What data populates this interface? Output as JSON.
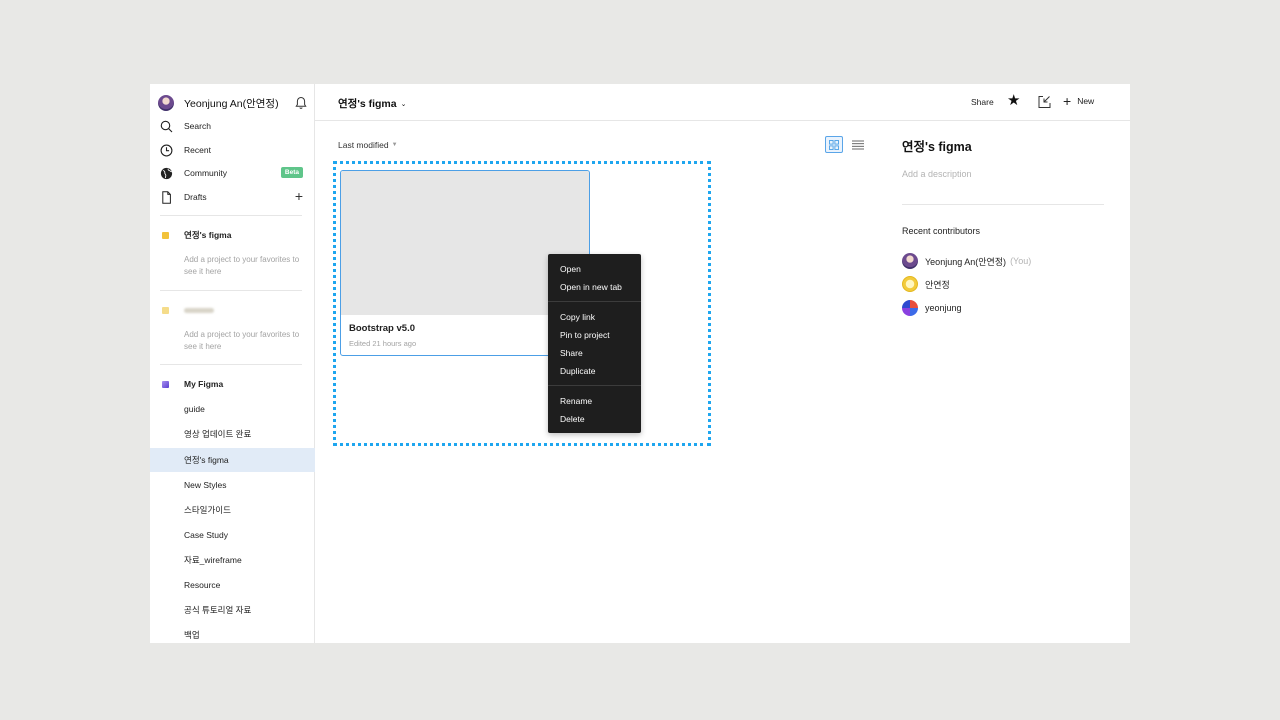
{
  "sidebar": {
    "user_name": "Yeonjung An(안연정)",
    "nav": [
      {
        "label": "Search",
        "icon": "search-icon"
      },
      {
        "label": "Recent",
        "icon": "clock-icon"
      },
      {
        "label": "Community",
        "icon": "globe-icon",
        "badge": "Beta"
      },
      {
        "label": "Drafts",
        "icon": "file-icon",
        "action": "+"
      }
    ],
    "teams": [
      {
        "label": "연정's figma",
        "color": "#f2c23a",
        "hint": "Add a project to your favorites to see it here"
      },
      {
        "label": "",
        "color": "#f5dc8a",
        "hint": "Add a project to your favorites to see it here"
      },
      {
        "label": "My Figma",
        "color": "#7b5fe0"
      }
    ],
    "projects": [
      "guide",
      "영상 업데이트 완료",
      "연정's figma",
      "New Styles",
      "스타일가이드",
      "Case Study",
      "자료_wireframe",
      "Resource",
      "공식 튜토리얼 자료",
      "백업"
    ],
    "active_project": "연정's figma"
  },
  "topbar": {
    "title": "연정's figma",
    "share_label": "Share",
    "new_label": "New"
  },
  "main": {
    "sort_label": "Last modified",
    "file": {
      "name": "Bootstrap v5.0",
      "meta": "Edited 21 hours ago"
    },
    "context_menu": [
      "Open",
      "Open in new tab",
      "Copy link",
      "Pin to project",
      "Share",
      "Duplicate",
      "Rename",
      "Delete"
    ]
  },
  "right_panel": {
    "title": "연정's figma",
    "description_placeholder": "Add a description",
    "contributors_heading": "Recent contributors",
    "contributors": [
      {
        "name": "Yeonjung An(안연정)",
        "suffix": "(You)"
      },
      {
        "name": "안연정"
      },
      {
        "name": "yeonjung"
      }
    ]
  },
  "colors": {
    "accent": "#4c9fe6",
    "selection": "#1ea6ef",
    "active_row": "#e1ebf7",
    "beta": "#5fc58a"
  }
}
